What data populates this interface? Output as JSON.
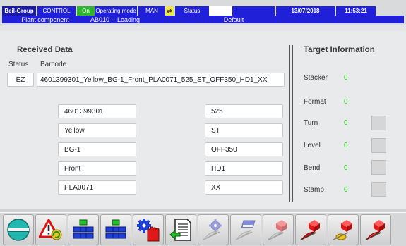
{
  "header": {
    "company": "Beil-Group",
    "control_label": "CONTROL",
    "control_state": "On",
    "mode_label": "Operating mode",
    "mode_value": "MAN",
    "status_label": "Status",
    "status_value": "",
    "date": "13/07/2018",
    "time": "11:53:21",
    "plant_label": "Plant component",
    "plant_value": "AB010 -- Loading",
    "profile": "Default"
  },
  "received": {
    "title": "Received Data",
    "status_header": "Status",
    "barcode_header": "Barcode",
    "status_value": "EZ",
    "barcode_value": "4601399301_Yellow_BG-1_Front_PLA0071_525_ST_OFF350_HD1_XX",
    "left_fields": [
      "4601399301",
      "Yellow",
      "BG-1",
      "Front",
      "PLA0071"
    ],
    "right_fields": [
      "525",
      "ST",
      "OFF350",
      "HD1",
      "XX"
    ]
  },
  "target": {
    "title": "Target Information",
    "items": [
      {
        "label": "Stacker",
        "value": "0"
      },
      {
        "label": "Format",
        "value": "0"
      },
      {
        "label": "Turn",
        "value": "0"
      },
      {
        "label": "Level",
        "value": "0"
      },
      {
        "label": "Bend",
        "value": "0"
      },
      {
        "label": "Stamp",
        "value": "0"
      }
    ]
  },
  "toolbar": {
    "buttons": [
      {
        "icon": "home-globe-icon"
      },
      {
        "icon": "warning-alarm-icon"
      },
      {
        "icon": "conveyor-blocks-icon"
      },
      {
        "icon": "conveyor-blocks-icon"
      },
      {
        "icon": "gear-hand-icon"
      },
      {
        "icon": "document-import-icon"
      },
      {
        "icon": "gear-feather-icon"
      },
      {
        "icon": "stamp-feather-icon"
      },
      {
        "icon": "red-cube-pen-icon"
      },
      {
        "icon": "red-cube-pen-icon"
      },
      {
        "icon": "red-cube-pen-icon"
      },
      {
        "icon": "red-cube-pen-icon"
      }
    ]
  },
  "colors": {
    "header_navy": "#1b1aa8",
    "header_blue": "#2020d8",
    "control_on": "#2db62d",
    "target_value": "#22cc22"
  }
}
